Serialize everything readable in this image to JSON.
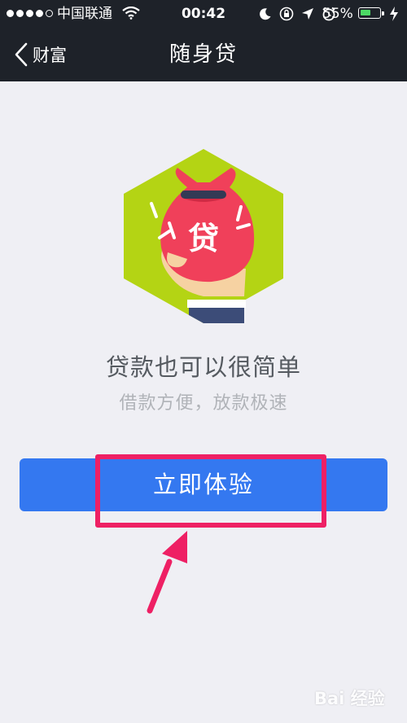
{
  "status_bar": {
    "carrier": "中国联通",
    "time": "00:42",
    "battery": "55%",
    "battery_level": 0.55
  },
  "nav": {
    "back_label": "财富",
    "title": "随身贷"
  },
  "hero": {
    "badge_char": "贷"
  },
  "content": {
    "headline": "贷款也可以很简单",
    "subline": "借款方便，放款极速",
    "cta_label": "立即体验"
  },
  "watermark": "Bai 经验",
  "colors": {
    "topbar": "#1e2229",
    "background": "#efeff4",
    "cta": "#3478f0",
    "highlight": "#ee2064",
    "hexagon": "#b4d414",
    "bag": "#f0405a"
  },
  "icons": [
    "signal-dots-icon",
    "wifi-icon",
    "moon-icon",
    "orientation-lock-icon",
    "location-arrow-icon",
    "alarm-icon",
    "battery-icon",
    "charging-icon",
    "chevron-left-icon",
    "money-bag-illustration"
  ]
}
